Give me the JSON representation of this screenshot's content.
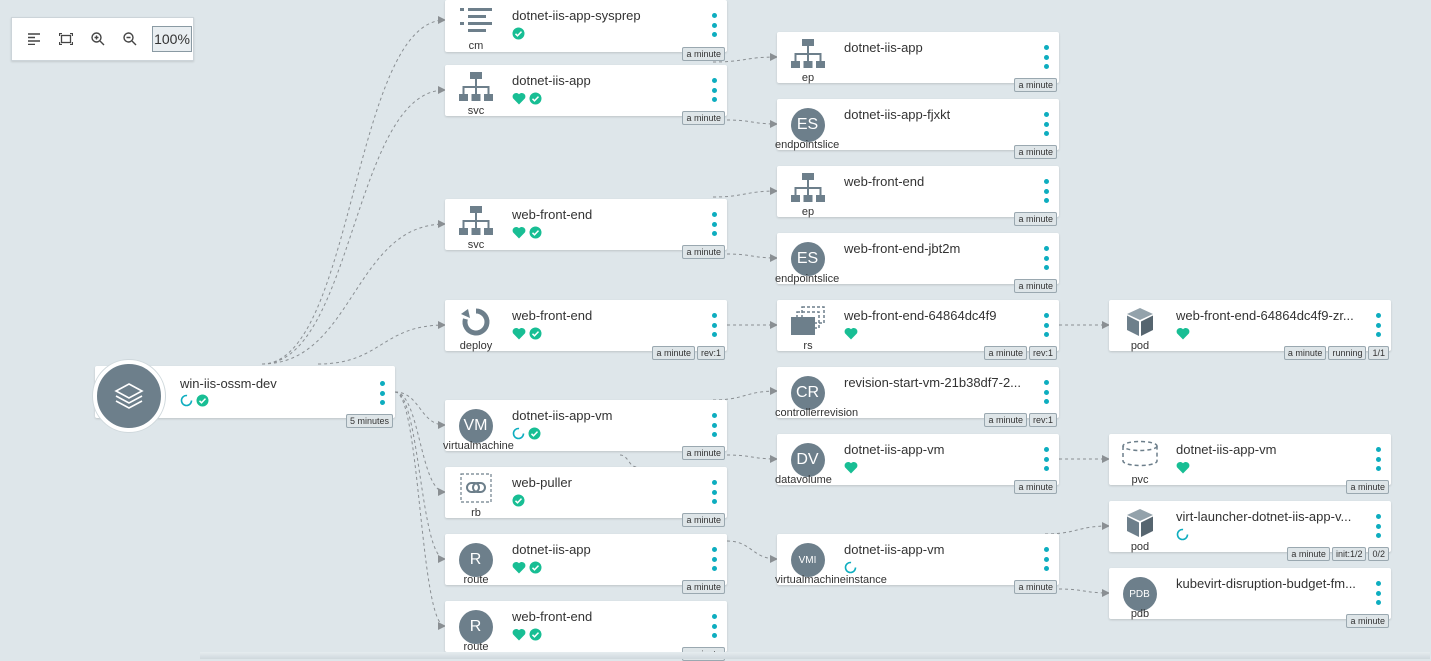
{
  "toolbar": {
    "zoom": "100%",
    "buttons": [
      "align-left-icon",
      "fit-screen-icon",
      "zoom-in-icon",
      "zoom-out-icon"
    ]
  },
  "colors": {
    "accent": "#0dadbf",
    "healthy": "#18be94",
    "icon_gray": "#6d7f8b",
    "background": "#dee6ea"
  },
  "app": {
    "name": "win-iis-ossm-dev",
    "age": "5 minutes",
    "status": [
      "progressing-icon",
      "synced-icon"
    ]
  },
  "nodes": [
    {
      "id": "n1",
      "kind": "cm",
      "icon": "list-icon",
      "title": "dotnet-iis-app-sysprep",
      "status": [
        "synced-icon"
      ],
      "badges": [
        "a minute"
      ]
    },
    {
      "id": "n2",
      "kind": "svc",
      "icon": "network-icon",
      "title": "dotnet-iis-app",
      "status": [
        "heart-icon",
        "synced-icon"
      ],
      "badges": [
        "a minute"
      ]
    },
    {
      "id": "n3",
      "kind": "svc",
      "icon": "network-icon",
      "title": "web-front-end",
      "status": [
        "heart-icon",
        "synced-icon"
      ],
      "badges": [
        "a minute"
      ]
    },
    {
      "id": "n4",
      "kind": "deploy",
      "icon": "refresh-icon",
      "title": "web-front-end",
      "status": [
        "heart-icon",
        "synced-icon"
      ],
      "badges": [
        "a minute",
        "rev:1"
      ]
    },
    {
      "id": "n5",
      "kind": "virtualmachine",
      "icon": "VM",
      "title": "dotnet-iis-app-vm",
      "status": [
        "progressing-icon",
        "synced-icon"
      ],
      "badges": [
        "a minute"
      ]
    },
    {
      "id": "n6",
      "kind": "rb",
      "icon": "link-icon",
      "title": "web-puller",
      "status": [
        "synced-icon"
      ],
      "badges": [
        "a minute"
      ]
    },
    {
      "id": "n7",
      "kind": "route",
      "icon": "R",
      "title": "dotnet-iis-app",
      "status": [
        "heart-icon",
        "synced-icon"
      ],
      "badges": [
        "a minute"
      ]
    },
    {
      "id": "n8",
      "kind": "route",
      "icon": "R",
      "title": "web-front-end",
      "status": [
        "heart-icon",
        "synced-icon"
      ],
      "badges": [
        "a minute"
      ]
    },
    {
      "id": "n9",
      "kind": "ep",
      "icon": "network-icon",
      "title": "dotnet-iis-app",
      "status": [],
      "badges": [
        "a minute"
      ]
    },
    {
      "id": "n10",
      "kind": "endpointslice",
      "icon": "ES",
      "title": "dotnet-iis-app-fjxkt",
      "status": [],
      "badges": [
        "a minute"
      ]
    },
    {
      "id": "n11",
      "kind": "ep",
      "icon": "network-icon",
      "title": "web-front-end",
      "status": [],
      "badges": [
        "a minute"
      ]
    },
    {
      "id": "n12",
      "kind": "endpointslice",
      "icon": "ES",
      "title": "web-front-end-jbt2m",
      "status": [],
      "badges": [
        "a minute"
      ]
    },
    {
      "id": "n13",
      "kind": "rs",
      "icon": "replicaset-icon",
      "title": "web-front-end-64864dc4f9",
      "status": [
        "heart-icon"
      ],
      "badges": [
        "a minute",
        "rev:1"
      ]
    },
    {
      "id": "n14",
      "kind": "controllerrevision",
      "icon": "CR",
      "title": "revision-start-vm-21b38df7-2...",
      "status": [],
      "badges": [
        "a minute",
        "rev:1"
      ]
    },
    {
      "id": "n15",
      "kind": "datavolume",
      "icon": "DV",
      "title": "dotnet-iis-app-vm",
      "status": [
        "heart-icon"
      ],
      "badges": [
        "a minute"
      ]
    },
    {
      "id": "n16",
      "kind": "virtualmachineinstance",
      "icon": "VMI",
      "title": "dotnet-iis-app-vm",
      "status": [
        "progressing-icon"
      ],
      "badges": [
        "a minute"
      ]
    },
    {
      "id": "n17",
      "kind": "pod",
      "icon": "cube-icon",
      "title": "web-front-end-64864dc4f9-zr...",
      "status": [
        "heart-icon"
      ],
      "badges": [
        "a minute",
        "running",
        "1/1"
      ]
    },
    {
      "id": "n18",
      "kind": "pvc",
      "icon": "disk-icon",
      "title": "dotnet-iis-app-vm",
      "status": [
        "heart-icon"
      ],
      "badges": [
        "a minute"
      ]
    },
    {
      "id": "n19",
      "kind": "pod",
      "icon": "cube-icon",
      "title": "virt-launcher-dotnet-iis-app-v...",
      "status": [
        "progressing-icon"
      ],
      "badges": [
        "a minute",
        "init:1/2",
        "0/2"
      ]
    },
    {
      "id": "n20",
      "kind": "pdb",
      "icon": "PDB",
      "title": "kubevirt-disruption-budget-fm...",
      "status": [],
      "badges": [
        "a minute"
      ]
    }
  ]
}
